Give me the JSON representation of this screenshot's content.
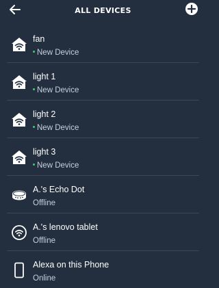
{
  "header": {
    "title": "ALL DEVICES"
  },
  "devices": [
    {
      "name": "fan",
      "status": "New Device",
      "is_new": true,
      "icon": "home-wifi-icon"
    },
    {
      "name": "light 1",
      "status": "New Device",
      "is_new": true,
      "icon": "home-wifi-icon"
    },
    {
      "name": "light 2",
      "status": "New Device",
      "is_new": true,
      "icon": "home-wifi-icon"
    },
    {
      "name": "light 3",
      "status": "New Device",
      "is_new": true,
      "icon": "home-wifi-icon"
    },
    {
      "name": "A.'s Echo Dot",
      "status": "Offline",
      "is_new": false,
      "icon": "echo-dot-icon"
    },
    {
      "name": "A.'s lenovo tablet",
      "status": "Offline",
      "is_new": false,
      "icon": "tablet-wifi-icon"
    },
    {
      "name": "Alexa on this Phone",
      "status": "Online",
      "is_new": false,
      "icon": "phone-icon"
    }
  ],
  "colors": {
    "background": "#232f3e",
    "new_dot": "#3ecf7c",
    "status_text": "#c6d1dc"
  }
}
